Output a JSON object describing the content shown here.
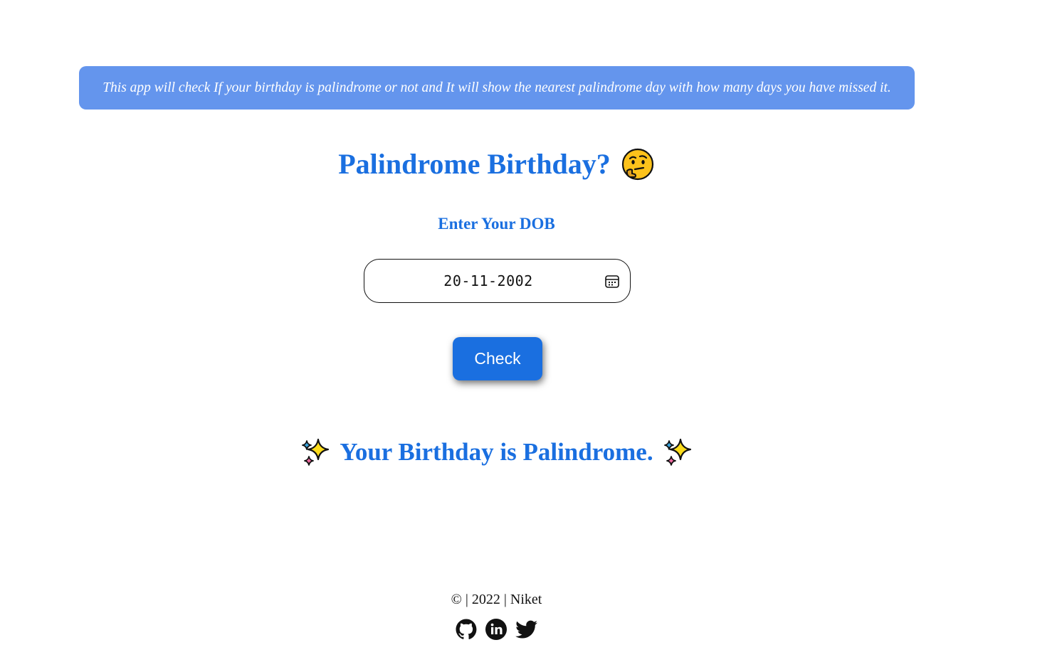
{
  "banner": {
    "text": "This app will check If your birthday is palindrome or not and It will show the nearest palindrome day with how many days you have missed it."
  },
  "header": {
    "title": "Palindrome Birthday?",
    "title_emoji": "thinking-face-icon"
  },
  "form": {
    "dob_label": "Enter Your DOB",
    "dob_value": "20-11-2002",
    "check_label": "Check"
  },
  "result": {
    "message": "Your Birthday is Palindrome.",
    "emoji": "sparkles-icon"
  },
  "footer": {
    "text": "© | 2022 | Niket",
    "links": [
      "github-icon",
      "linkedin-icon",
      "twitter-icon"
    ]
  },
  "colors": {
    "banner_bg": "#6495ed",
    "accent": "#1a6fe0",
    "text": "#111111"
  }
}
